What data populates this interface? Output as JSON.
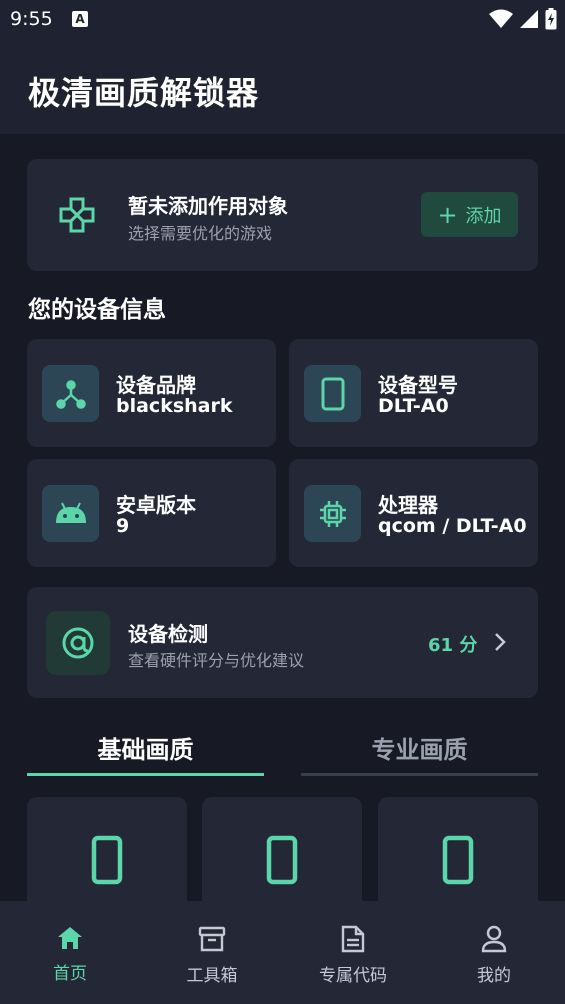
{
  "status": {
    "time": "9:55",
    "app_icon": "A"
  },
  "app": {
    "title": "极清画质解锁器"
  },
  "target": {
    "title": "暂未添加作用对象",
    "subtitle": "选择需要优化的游戏",
    "add_label": "添加",
    "add_icon": "+"
  },
  "device_section": {
    "title": "您的设备信息"
  },
  "device": {
    "brand": {
      "label": "设备品牌",
      "value": "blackshark",
      "icon": "share-nodes-icon"
    },
    "model": {
      "label": "设备型号",
      "value": "DLT-A0",
      "icon": "phone-icon"
    },
    "android": {
      "label": "安卓版本",
      "value": "9",
      "icon": "android-icon"
    },
    "cpu": {
      "label": "处理器",
      "value": "qcom / DLT-A0",
      "icon": "chip-icon"
    }
  },
  "detect": {
    "title": "设备检测",
    "subtitle": "查看硬件评分与优化建议",
    "score": "61 分"
  },
  "tabs": [
    {
      "label": "基础画质",
      "active": true
    },
    {
      "label": "专业画质",
      "active": false
    }
  ],
  "nav": [
    {
      "label": "首页",
      "icon": "home-icon",
      "active": true
    },
    {
      "label": "工具箱",
      "icon": "archive-icon",
      "active": false
    },
    {
      "label": "专属代码",
      "icon": "document-icon",
      "active": false
    },
    {
      "label": "我的",
      "icon": "person-icon",
      "active": false
    }
  ],
  "colors": {
    "accent": "#5cd6a8",
    "background": "#171a24",
    "card": "#232736",
    "icon_box": "#2c4656"
  }
}
